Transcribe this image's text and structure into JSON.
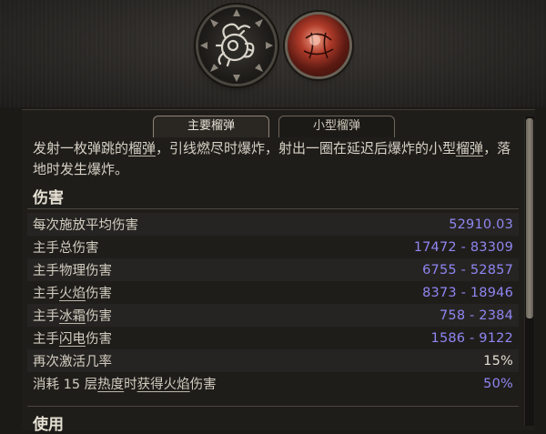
{
  "skill_icons": {
    "primary": {
      "icon": "spiked-grenade-icon"
    },
    "secondary": {
      "icon": "fire-grenade-icon",
      "accent": "#b03b2a"
    }
  },
  "tabs": [
    {
      "label": "主要榴弹",
      "active": true
    },
    {
      "label": "小型榴弹",
      "active": false
    }
  ],
  "description": {
    "parts": [
      "发射一枚弹跳的",
      "榴弹",
      "，引线燃尽时爆炸，射出一圈在延迟后爆炸的小型",
      "榴弹",
      "，落地时发生爆炸。"
    ]
  },
  "sections": {
    "damage_title": "伤害",
    "usage_title": "使用"
  },
  "stats": [
    {
      "label_parts": [
        "每次施放平均伤害"
      ],
      "value": "52910.03",
      "highlight": true
    },
    {
      "label_parts": [
        "主手总伤害"
      ],
      "value": "17472 - 83309",
      "highlight": true
    },
    {
      "label_parts": [
        "主手物理伤害"
      ],
      "value": "6755 - 52857",
      "highlight": true
    },
    {
      "label_parts": [
        "主手",
        "火焰",
        "伤害"
      ],
      "value": "8373 - 18946",
      "highlight": true
    },
    {
      "label_parts": [
        "主手",
        "冰霜",
        "伤害"
      ],
      "value": "758 - 2384",
      "highlight": true
    },
    {
      "label_parts": [
        "主手",
        "闪电",
        "伤害"
      ],
      "value": "1586 - 9122",
      "highlight": true
    },
    {
      "label_parts": [
        "再次激活几率"
      ],
      "value": "15%",
      "highlight": false
    },
    {
      "label_parts": [
        "消耗 15 层",
        "热度",
        "时",
        "获得",
        "火焰",
        "伤害"
      ],
      "value": "50%",
      "highlight": true
    }
  ],
  "colors": {
    "value_highlight": "#8f86f2",
    "value_plain": "#e2ddd2",
    "panel_bg": "#1f1d1a"
  }
}
